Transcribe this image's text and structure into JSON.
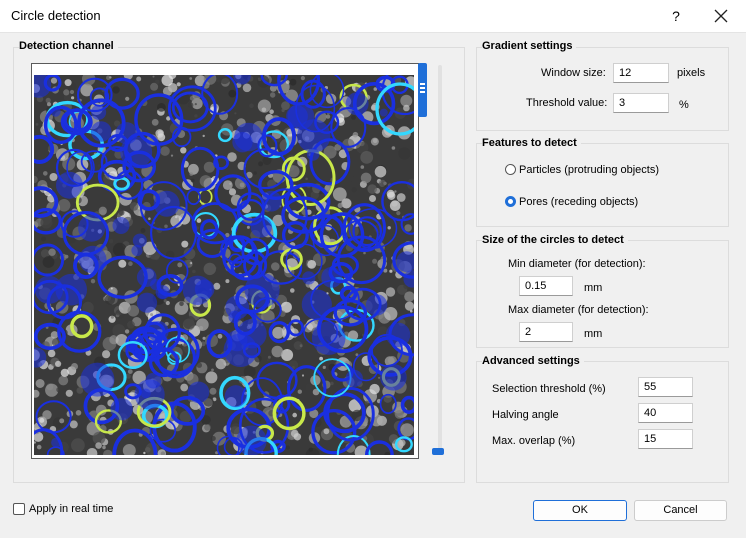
{
  "window": {
    "title": "Circle detection",
    "help_label": "?"
  },
  "detection_channel": {
    "title": "Detection channel"
  },
  "gradient_settings": {
    "title": "Gradient settings",
    "window_size_label": "Window size:",
    "window_size_value": "12",
    "window_size_unit": "pixels",
    "threshold_label": "Threshold value:",
    "threshold_value": "3",
    "threshold_unit": "%"
  },
  "features": {
    "title": "Features to detect",
    "option_particles": "Particles (protruding objects)",
    "option_pores": "Pores (receding objects)",
    "selected": "pores"
  },
  "circle_size": {
    "title": "Size of the circles to detect",
    "min_label": "Min diameter (for detection):",
    "min_value": "0.15",
    "min_unit": "mm",
    "max_label": "Max diameter (for detection):",
    "max_value": "2",
    "max_unit": "mm"
  },
  "advanced": {
    "title": "Advanced settings",
    "selection_threshold_label": "Selection threshold (%)",
    "selection_threshold_value": "55",
    "halving_angle_label": "Halving angle",
    "halving_angle_value": "40",
    "max_overlap_label": "Max. overlap (%)",
    "max_overlap_value": "15"
  },
  "footer": {
    "realtime_label": "Apply in real time",
    "realtime_checked": false,
    "ok_label": "OK",
    "cancel_label": "Cancel"
  },
  "colors": {
    "accent": "#1f6fd8",
    "overlay_blue": "#1a2fe0",
    "overlay_cyan": "#33d8ff",
    "overlay_yellow": "#c8e84a"
  }
}
